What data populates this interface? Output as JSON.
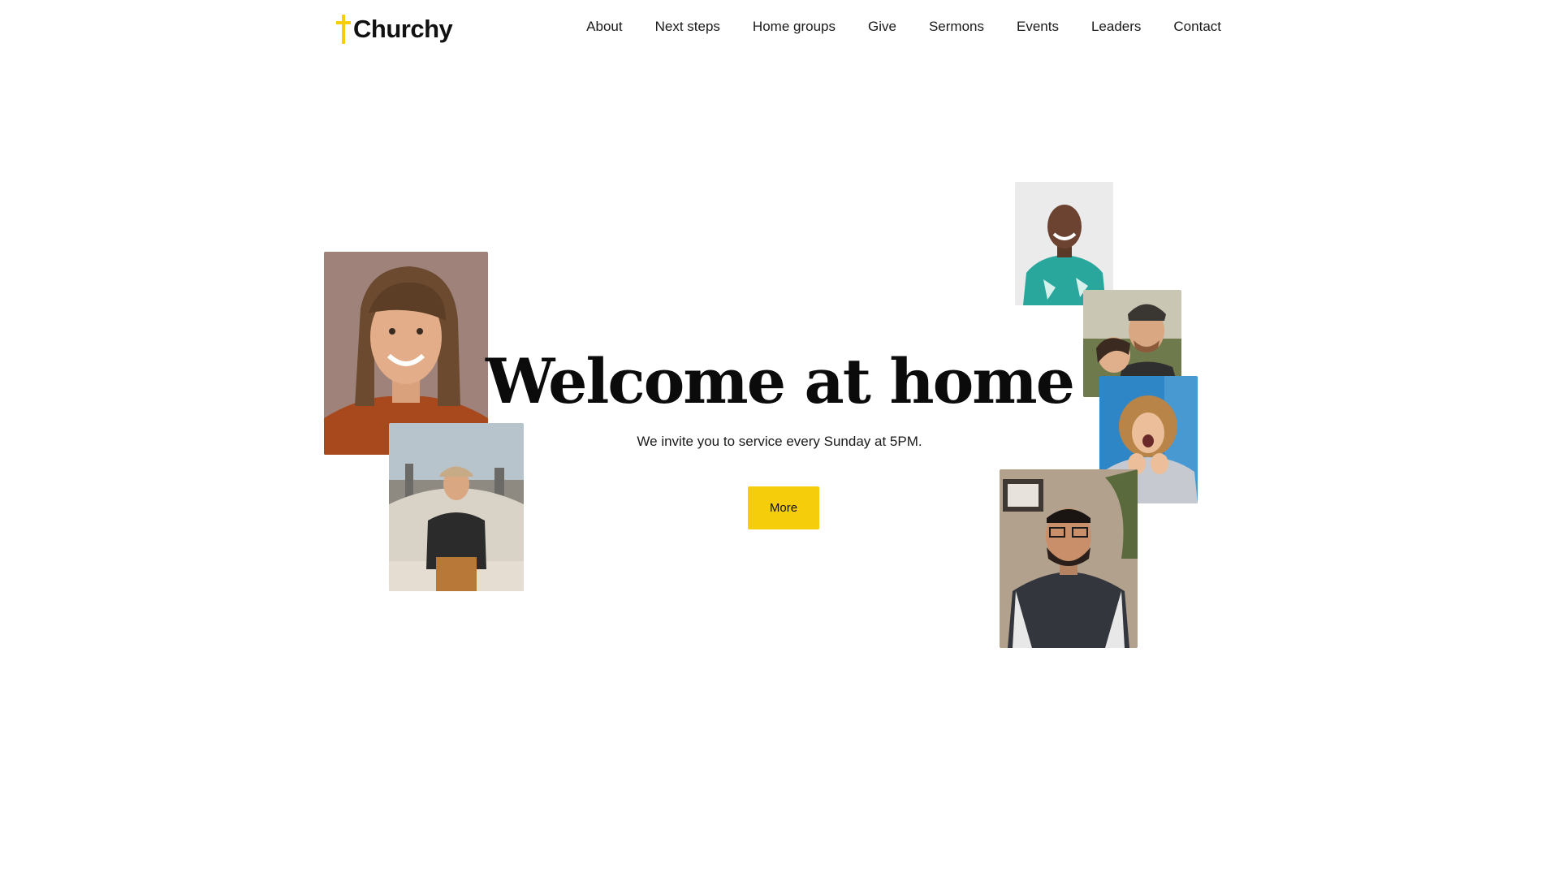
{
  "brand": {
    "name": "Churchy",
    "accent": "#f5cd0b"
  },
  "nav": {
    "items": [
      "About",
      "Next steps",
      "Home groups",
      "Give",
      "Sermons",
      "Events",
      "Leaders",
      "Contact"
    ]
  },
  "hero": {
    "title": "Welcome at home",
    "subtitle": "We invite you to service every Sunday at 5PM.",
    "cta_label": "More"
  },
  "photos": [
    "smiling-woman-photo",
    "man-with-cap-photo",
    "man-teal-shirt-photo",
    "couple-hugging-photo",
    "laughing-woman-photo",
    "man-glasses-photo"
  ]
}
